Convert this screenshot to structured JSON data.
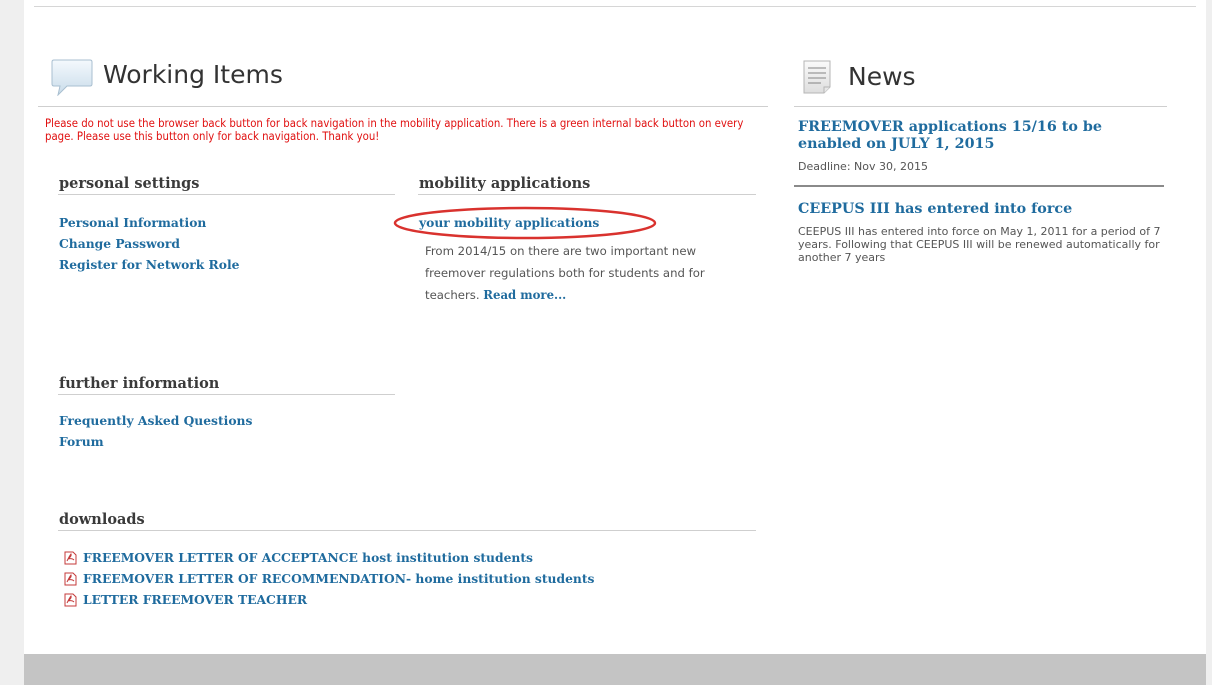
{
  "working_items": {
    "title": "Working Items",
    "warning": "Please do not use the browser back button for back navigation in the mobility application. There is a green internal back button on every page. Please use this button only for back navigation. Thank you!"
  },
  "personal_settings": {
    "heading": "personal settings",
    "links": [
      "Personal Information",
      "Change Password",
      "Register for Network Role"
    ]
  },
  "mobility_applications": {
    "heading": "mobility applications",
    "link": "your mobility applications",
    "description": "From 2014/15 on there are two important new freemover regulations both for students and for teachers.",
    "read_more": "Read more..."
  },
  "further_information": {
    "heading": "further information",
    "links": [
      "Frequently Asked Questions",
      "Forum"
    ]
  },
  "downloads": {
    "heading": "downloads",
    "items": [
      "FREEMOVER LETTER OF ACCEPTANCE host institution students",
      "FREEMOVER LETTER OF RECOMMENDATION- home institution students",
      "LETTER FREEMOVER TEACHER"
    ]
  },
  "news": {
    "title": "News",
    "items": [
      {
        "title": "FREEMOVER applications 15/16 to be enabled on JULY 1, 2015",
        "text": "Deadline: Nov 30, 2015"
      },
      {
        "title": "CEEPUS III has entered into force",
        "text": "CEEPUS III has entered into force on May 1, 2011 for a period of 7 years. Following that CEEPUS III will be renewed automatically for another 7 years"
      }
    ]
  },
  "colors": {
    "link": "#1f6b9e",
    "warning": "#e01010",
    "highlight_ellipse": "#d9322e"
  }
}
